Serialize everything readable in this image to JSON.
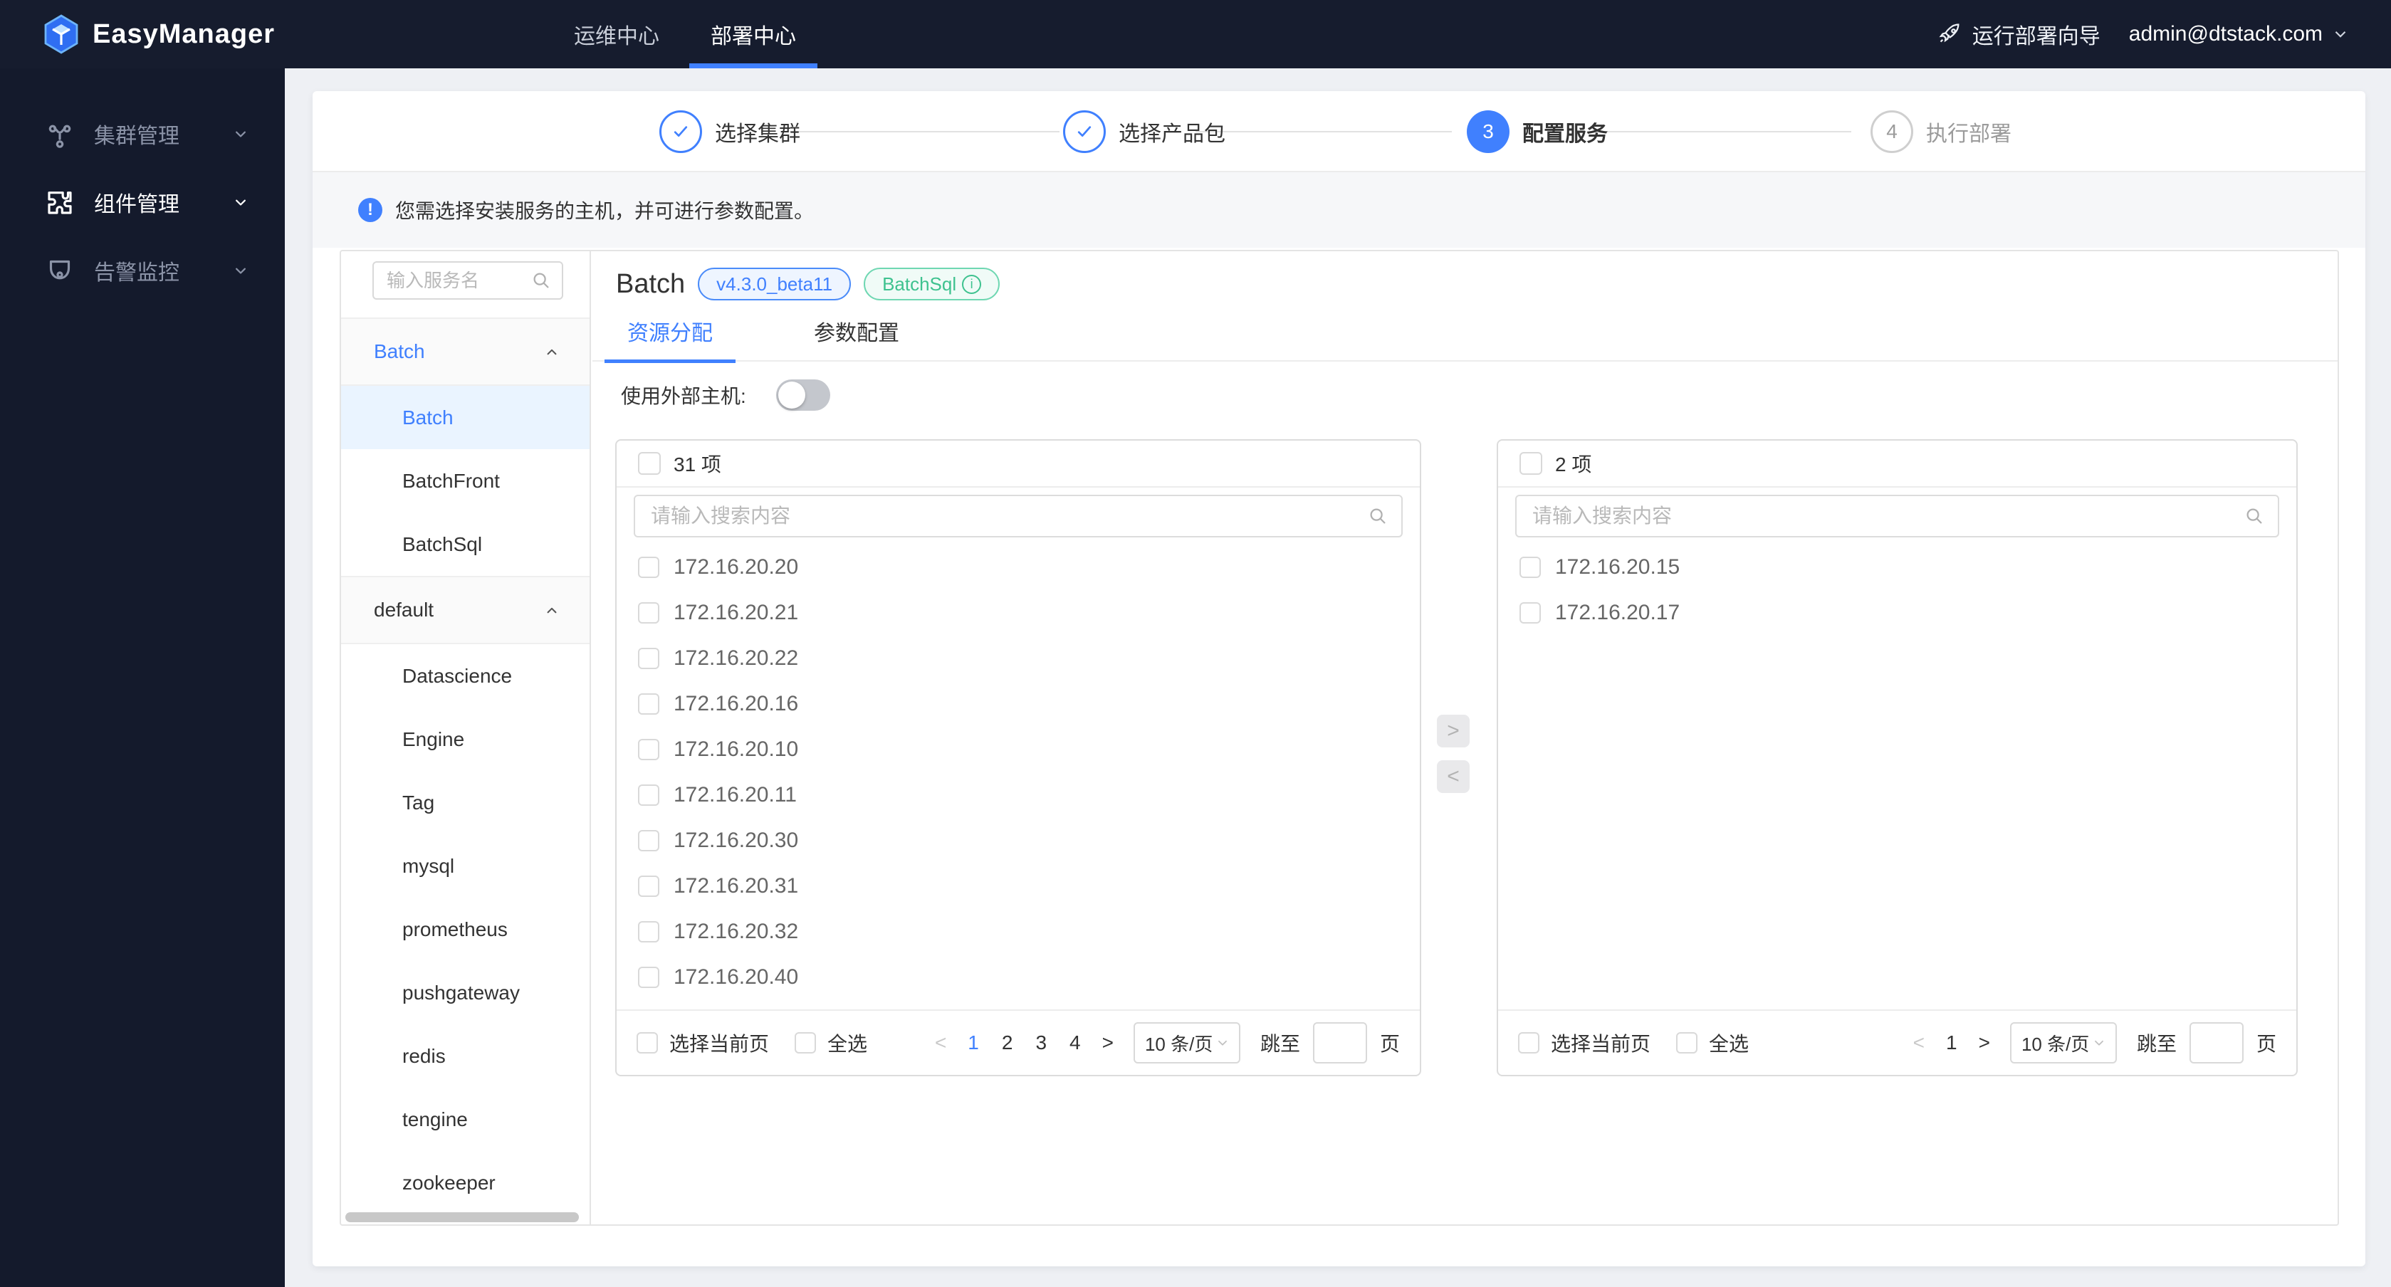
{
  "topbar": {
    "brand": "EasyManager",
    "nav": [
      {
        "label": "运维中心",
        "active": false
      },
      {
        "label": "部署中心",
        "active": true
      }
    ],
    "wizard_label": "运行部署向导",
    "user_email": "admin@dtstack.com"
  },
  "sidebar": {
    "items": [
      {
        "label": "集群管理",
        "icon": "cluster-icon",
        "active": false
      },
      {
        "label": "组件管理",
        "icon": "component-icon",
        "active": true
      },
      {
        "label": "告警监控",
        "icon": "alert-monitor-icon",
        "active": false
      }
    ]
  },
  "steps": [
    {
      "label": "选择集群",
      "status": "done"
    },
    {
      "label": "选择产品包",
      "status": "done"
    },
    {
      "label": "配置服务",
      "status": "current",
      "number": "3"
    },
    {
      "label": "执行部署",
      "status": "pending",
      "number": "4"
    }
  ],
  "notice": {
    "text": "您需选择安装服务的主机，并可进行参数配置。"
  },
  "service_panel": {
    "search_placeholder": "输入服务名",
    "groups": [
      {
        "name": "Batch",
        "name_blue": true,
        "items": [
          {
            "label": "Batch",
            "selected": true
          },
          {
            "label": "BatchFront",
            "selected": false
          },
          {
            "label": "BatchSql",
            "selected": false
          }
        ]
      },
      {
        "name": "default",
        "name_blue": false,
        "items": [
          {
            "label": "Datascience",
            "selected": false
          },
          {
            "label": "Engine",
            "selected": false
          },
          {
            "label": "Tag",
            "selected": false
          },
          {
            "label": "mysql",
            "selected": false
          },
          {
            "label": "prometheus",
            "selected": false
          },
          {
            "label": "pushgateway",
            "selected": false
          },
          {
            "label": "redis",
            "selected": false
          },
          {
            "label": "tengine",
            "selected": false
          },
          {
            "label": "zookeeper",
            "selected": false
          }
        ]
      }
    ]
  },
  "content": {
    "title": "Batch",
    "version_tag": "v4.3.0_beta11",
    "service_tag": "BatchSql",
    "tabs": [
      {
        "label": "资源分配",
        "active": true
      },
      {
        "label": "参数配置",
        "active": false
      }
    ],
    "external_host_label": "使用外部主机:",
    "external_host_on": false
  },
  "transfer": {
    "left": {
      "count_label": "31 项",
      "search_placeholder": "请输入搜索内容",
      "hosts": [
        "172.16.20.20",
        "172.16.20.21",
        "172.16.20.22",
        "172.16.20.16",
        "172.16.20.10",
        "172.16.20.11",
        "172.16.20.30",
        "172.16.20.31",
        "172.16.20.32",
        "172.16.20.40"
      ],
      "footer": {
        "select_page_label": "选择当前页",
        "select_all_label": "全选",
        "prev_enabled": false,
        "next_enabled": true,
        "pages": [
          {
            "label": "1",
            "active": true
          },
          {
            "label": "2",
            "active": false
          },
          {
            "label": "3",
            "active": false
          },
          {
            "label": "4",
            "active": false
          }
        ],
        "page_size_label": "10 条/页",
        "jump_label": "跳至",
        "page_unit_label": "页"
      }
    },
    "right": {
      "count_label": "2 项",
      "search_placeholder": "请输入搜索内容",
      "hosts": [
        "172.16.20.15",
        "172.16.20.17"
      ],
      "footer": {
        "select_page_label": "选择当前页",
        "select_all_label": "全选",
        "prev_enabled": false,
        "next_enabled": true,
        "pages": [
          {
            "label": "1",
            "active": false
          }
        ],
        "page_size_label": "10 条/页",
        "jump_label": "跳至",
        "page_unit_label": "页"
      }
    }
  },
  "colors": {
    "accent_blue": "#4080fe",
    "tag_green": "#3ec28f",
    "topbar_bg": "#161c2e",
    "sidebar_bg": "#141a2c",
    "selected_item_bg": "#eaf4ff"
  }
}
